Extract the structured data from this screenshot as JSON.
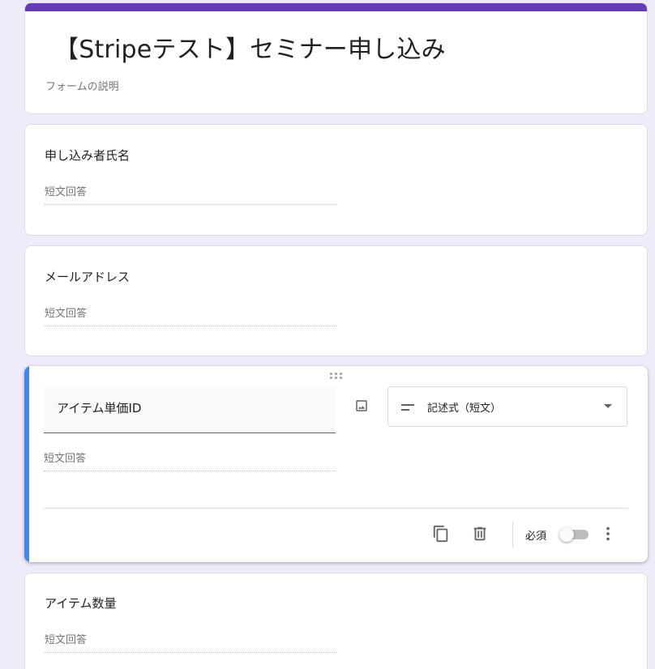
{
  "form": {
    "title": "【Stripeテスト】セミナー申し込み",
    "description": "フォームの説明"
  },
  "questions": [
    {
      "title": "申し込み者氏名",
      "answer_placeholder": "短文回答"
    },
    {
      "title": "メールアドレス",
      "answer_placeholder": "短文回答"
    },
    {
      "title": "アイテム単価ID",
      "answer_placeholder": "短文回答",
      "type_label": "記述式（短文）",
      "required_label": "必須",
      "required": false
    },
    {
      "title": "アイテム数量",
      "answer_placeholder": "短文回答"
    }
  ],
  "colors": {
    "theme": "#673ab7",
    "active_accent": "#4285f4",
    "background": "#efebf8"
  },
  "icons": {
    "drag": "drag-handle-icon",
    "image": "image-icon",
    "type": "short-text-icon",
    "dropdown": "caret-down-icon",
    "copy": "copy-icon",
    "delete": "trash-icon",
    "more": "more-vert-icon"
  }
}
